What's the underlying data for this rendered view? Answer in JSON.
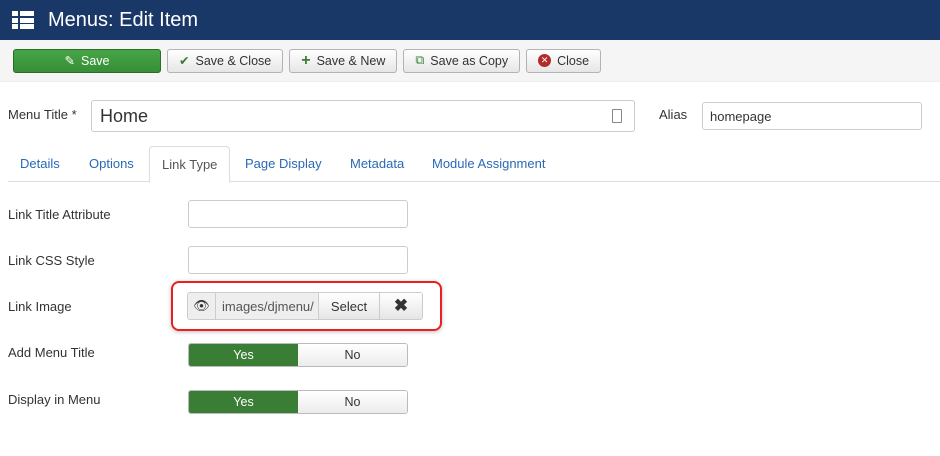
{
  "header": {
    "title": "Menus: Edit Item"
  },
  "toolbar": {
    "save": "Save",
    "save_close": "Save & Close",
    "save_new": "Save & New",
    "save_copy": "Save as Copy",
    "close": "Close"
  },
  "form": {
    "menu_title_label": "Menu Title *",
    "menu_title_value": "Home",
    "alias_label": "Alias",
    "alias_value": "homepage"
  },
  "tabs": [
    "Details",
    "Options",
    "Link Type",
    "Page Display",
    "Metadata",
    "Module Assignment"
  ],
  "fields": {
    "link_title_attr": "Link Title Attribute",
    "link_css_style": "Link CSS Style",
    "link_image": "Link Image",
    "link_image_value": "images/djmenu/",
    "select": "Select",
    "add_menu_title": "Add Menu Title",
    "display_in_menu": "Display in Menu",
    "yes": "Yes",
    "no": "No"
  }
}
